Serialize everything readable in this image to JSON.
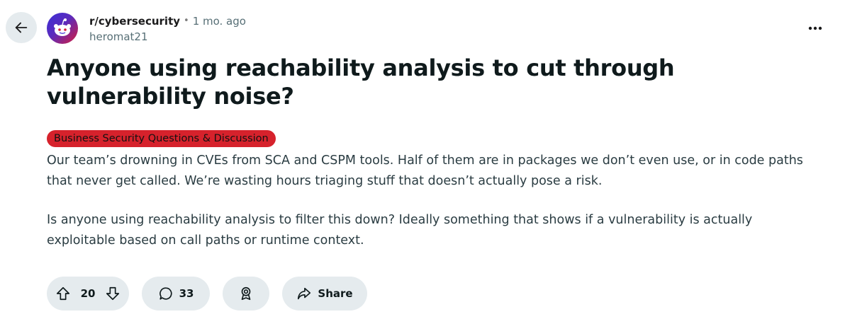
{
  "post": {
    "subreddit": "r/cybersecurity",
    "separator": "•",
    "age": "1 mo. ago",
    "author": "heromat21",
    "title": "Anyone using reachability analysis to cut through vulnerability noise?",
    "flair": "Business Security Questions & Discussion",
    "body": [
      "Our team’s drowning in CVEs from SCA and CSPM tools. Half of them are in packages we don’t even use, or in code paths that never get called. We’re wasting hours triaging stuff that doesn’t actually pose a risk.",
      "Is anyone using reachability analysis to filter this down? Ideally something that shows if a vulnerability is actually exploitable based on call paths or runtime context."
    ]
  },
  "actions": {
    "vote_count": "20",
    "comment_count": "33",
    "share_label": "Share"
  },
  "icons": {
    "back": "arrow-left-icon",
    "more": "ellipsis-icon",
    "upvote": "arrow-up-icon",
    "downvote": "arrow-down-icon",
    "comment": "speech-bubble-icon",
    "award": "award-icon",
    "share": "share-arrow-icon"
  },
  "colors": {
    "flair_background": "#d6222c",
    "pill_background": "#e5ebee"
  }
}
